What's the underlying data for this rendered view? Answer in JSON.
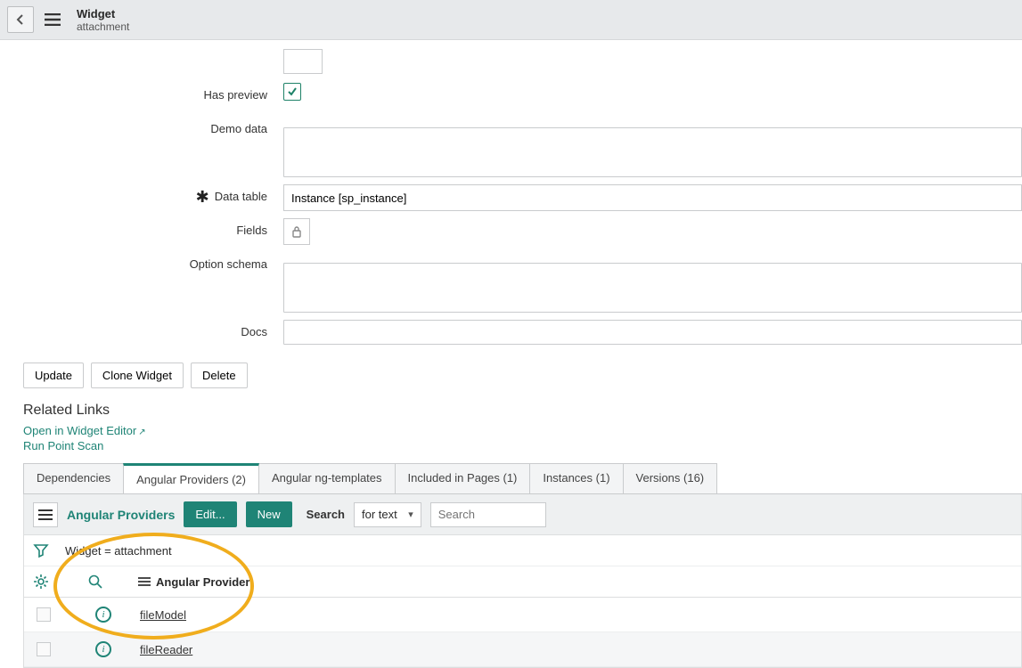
{
  "header": {
    "title": "Widget",
    "subtitle": "attachment"
  },
  "form": {
    "has_preview": {
      "label": "Has preview",
      "checked": true
    },
    "demo_data": {
      "label": "Demo data",
      "value": ""
    },
    "data_table": {
      "label": "Data table",
      "value": "Instance [sp_instance]",
      "required": true
    },
    "fields": {
      "label": "Fields"
    },
    "option_schema": {
      "label": "Option schema",
      "value": ""
    },
    "docs": {
      "label": "Docs",
      "value": ""
    }
  },
  "buttons": {
    "update": "Update",
    "clone": "Clone Widget",
    "delete": "Delete"
  },
  "related_links": {
    "heading": "Related Links",
    "open_editor": "Open in Widget Editor",
    "run_scan": "Run Point Scan"
  },
  "tabs": [
    {
      "label": "Dependencies"
    },
    {
      "label": "Angular Providers (2)",
      "active": true
    },
    {
      "label": "Angular ng-templates"
    },
    {
      "label": "Included in Pages (1)"
    },
    {
      "label": "Instances (1)"
    },
    {
      "label": "Versions (16)"
    }
  ],
  "list": {
    "title": "Angular Providers",
    "edit_btn": "Edit...",
    "new_btn": "New",
    "search_label": "Search",
    "search_mode": "for text",
    "search_placeholder": "Search",
    "breadcrumb": "Widget = attachment",
    "column": "Angular Provider",
    "rows": [
      {
        "name": "fileModel"
      },
      {
        "name": "fileReader"
      }
    ]
  }
}
